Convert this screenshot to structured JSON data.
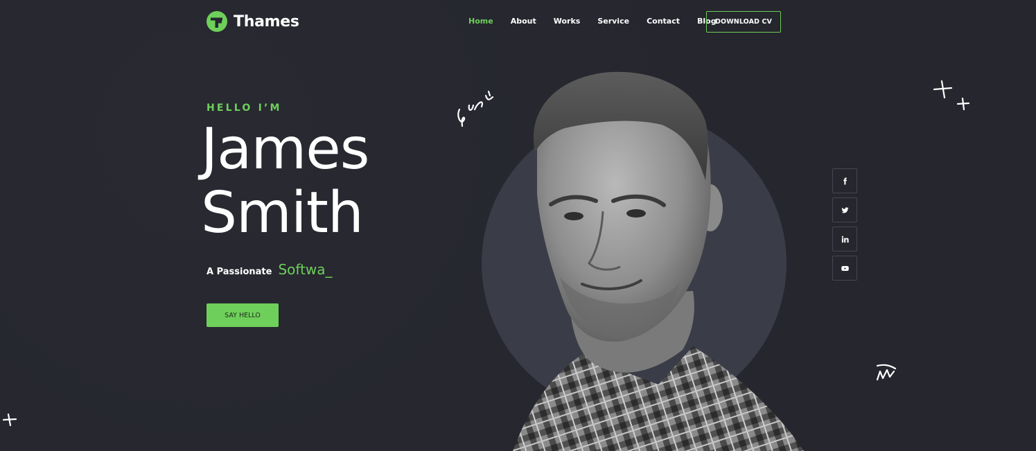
{
  "header": {
    "logo_text": "Thames",
    "nav": [
      {
        "label": "Home",
        "active": true
      },
      {
        "label": "About",
        "active": false
      },
      {
        "label": "Works",
        "active": false
      },
      {
        "label": "Service",
        "active": false
      },
      {
        "label": "Contact",
        "active": false
      },
      {
        "label": "Blog",
        "active": false
      }
    ],
    "download_label": "DOWNLOAD CV"
  },
  "hero": {
    "greeting": "HELLO I’M",
    "first_name": "James",
    "last_name": "Smith",
    "tagline_prefix": "A Passionate",
    "tagline_typed": "Softwa_",
    "cta_label": "SAY HELLO"
  },
  "social": [
    {
      "icon": "facebook-icon"
    },
    {
      "icon": "twitter-icon"
    },
    {
      "icon": "linkedin-icon"
    },
    {
      "icon": "youtube-icon"
    }
  ],
  "colors": {
    "background": "#25262e",
    "accent": "#6ed05a",
    "circle": "#3a3c47",
    "text": "#ffffff"
  }
}
